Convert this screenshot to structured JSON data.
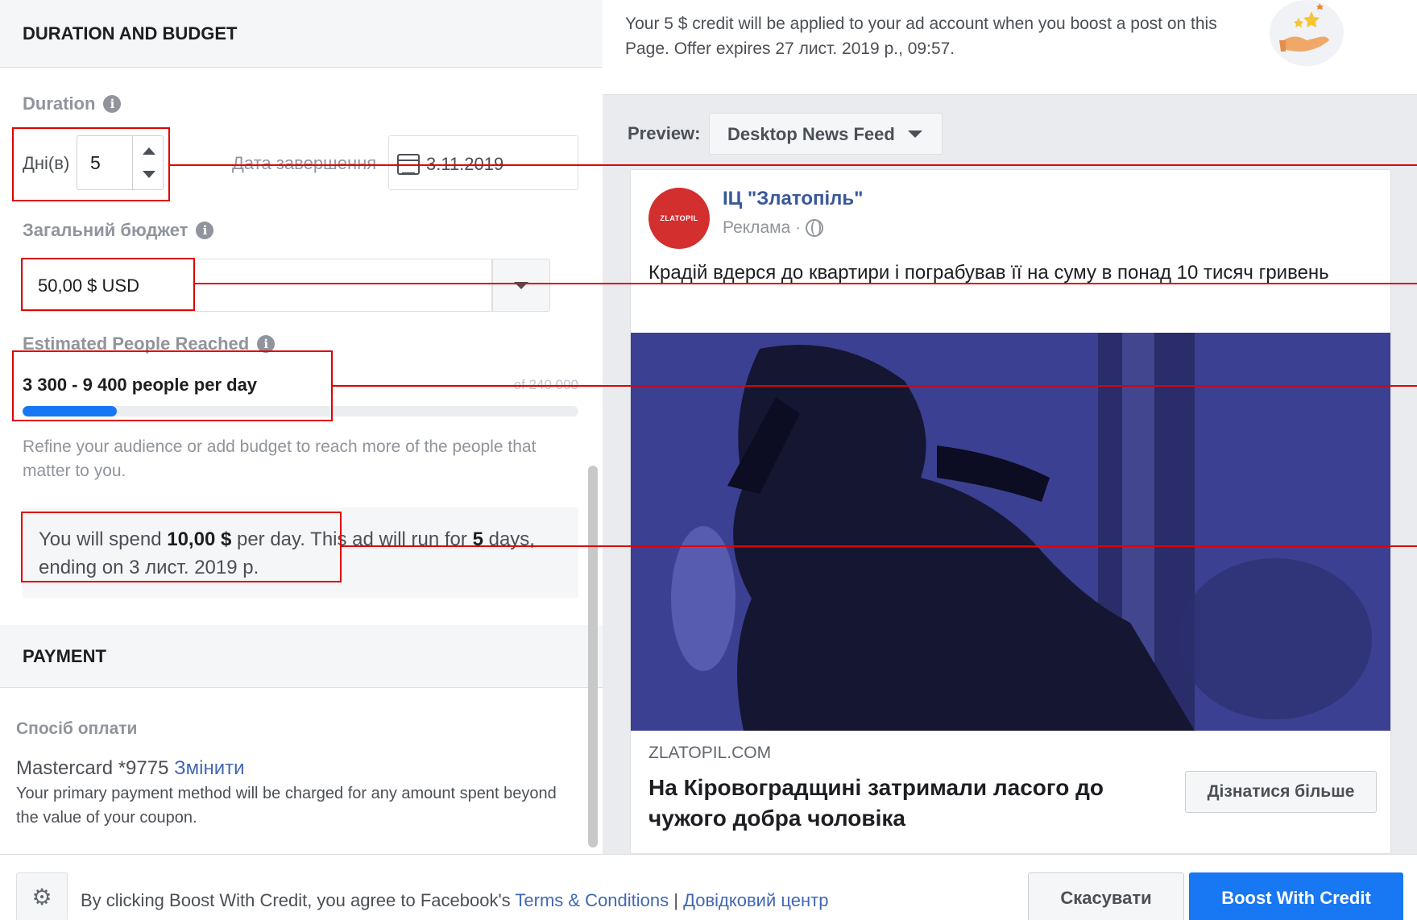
{
  "duration_budget": {
    "section_title": "DURATION AND BUDGET",
    "duration_label": "Duration",
    "days_label": "Дні(в)",
    "days_value": "5",
    "end_date_label": "Дата завершення",
    "end_date_value": "3.11.2019",
    "budget_label": "Загальний бюджет",
    "budget_value": "50,00 $ USD",
    "reach_label": "Estimated People Reached",
    "reach_value": "3 300 - 9 400 people per day",
    "reach_of": "of 240 000",
    "reach_fraction": 0.17,
    "refine_text": "Refine your audience or add budget to reach more of the people that matter to you.",
    "spend": {
      "part1": "You will spend ",
      "amount": "10,00 $",
      "part2": " per day. This ad will run for ",
      "days": "5",
      "part3": " days, ending on 3 лист. 2019 р."
    }
  },
  "payment": {
    "section_title": "PAYMENT",
    "method_label": "Спосіб оплати",
    "card": "Mastercard *9775",
    "change_link": "Змінити",
    "note": "Your primary payment method will be charged for any amount spent beyond the value of your coupon."
  },
  "credit_banner": {
    "text": "Your 5 $ credit will be applied to your ad account when you boost a post on this Page. Offer expires 27 лист. 2019 р., 09:57.",
    "icon": "hand-with-stars-icon"
  },
  "preview": {
    "label": "Preview:",
    "placement": "Desktop News Feed"
  },
  "post": {
    "avatar_text": "ZLATOPIL",
    "page_name": "ІЦ \"Златопіль\"",
    "sponsored": "Реклама ·",
    "text": "Крадій вдерся до квартири і пограбував її на суму в понад 10 тисяч гривень",
    "domain": "ZLATOPIL.COM",
    "headline": "На Кіровоградщині затримали ласого до чужого добра чоловіка",
    "cta": "Дізнатися більше"
  },
  "footer": {
    "agree_prefix": "By clicking Boost With Credit, you agree to Facebook's ",
    "terms_link": "Terms & Conditions",
    "separator": " | ",
    "help_link": "Довідковий центр",
    "cancel": "Скасувати",
    "boost": "Boost With Credit"
  },
  "colors": {
    "accent": "#1877f2",
    "link": "#4267b2",
    "annotation": "#e00000"
  }
}
